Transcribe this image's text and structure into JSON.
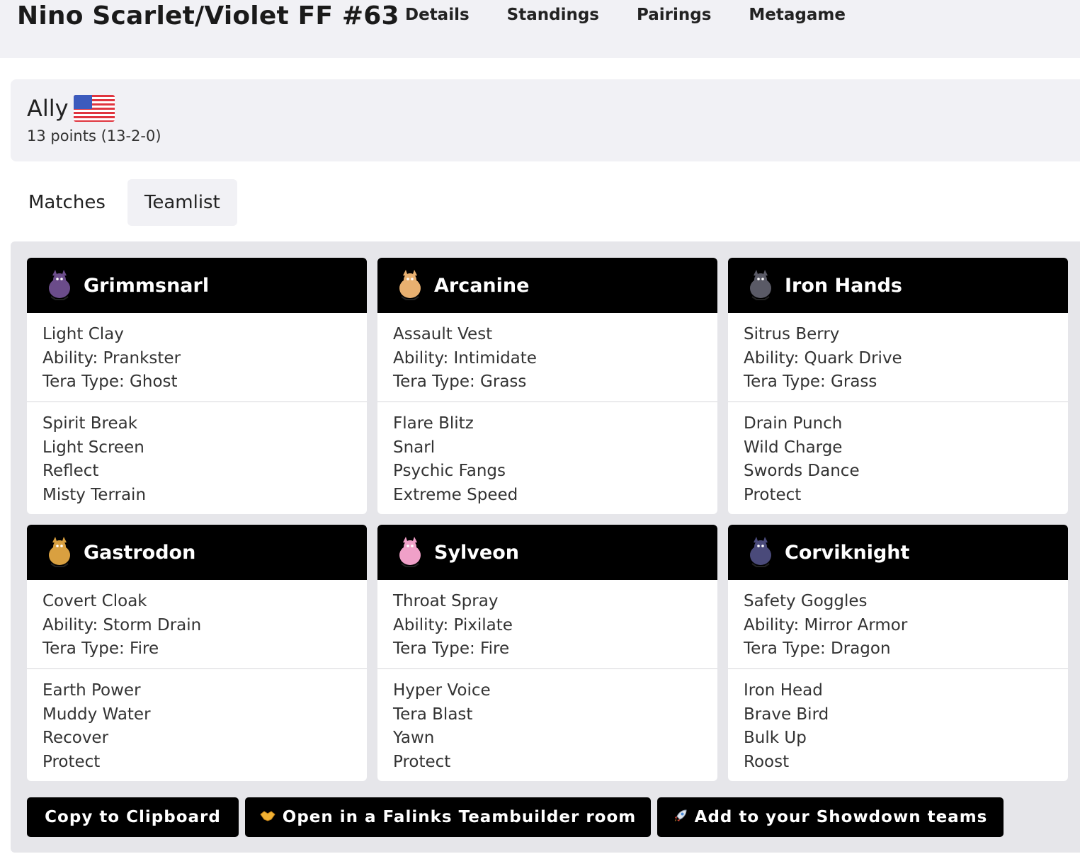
{
  "header": {
    "title": "Nino Scarlet/Violet FF #63",
    "nav": [
      "Details",
      "Standings",
      "Pairings",
      "Metagame"
    ]
  },
  "player": {
    "name": "Ally",
    "country_flag": "us-flag",
    "points": "13 points (13-2-0)"
  },
  "tabs": [
    {
      "label": "Matches",
      "active": false
    },
    {
      "label": "Teamlist",
      "active": true
    }
  ],
  "team": [
    {
      "name": "Grimmsnarl",
      "sprite_color": "#6b4c8a",
      "info": [
        "Light Clay",
        "Ability: Prankster",
        "Tera Type: Ghost"
      ],
      "moves": [
        "Spirit Break",
        "Light Screen",
        "Reflect",
        "Misty Terrain"
      ]
    },
    {
      "name": "Arcanine",
      "sprite_color": "#e8b070",
      "info": [
        "Assault Vest",
        "Ability: Intimidate",
        "Tera Type: Grass"
      ],
      "moves": [
        "Flare Blitz",
        "Snarl",
        "Psychic Fangs",
        "Extreme Speed"
      ]
    },
    {
      "name": "Iron Hands",
      "sprite_color": "#5a5a66",
      "info": [
        "Sitrus Berry",
        "Ability: Quark Drive",
        "Tera Type: Grass"
      ],
      "moves": [
        "Drain Punch",
        "Wild Charge",
        "Swords Dance",
        "Protect"
      ]
    },
    {
      "name": "Gastrodon",
      "sprite_color": "#d9a040",
      "info": [
        "Covert Cloak",
        "Ability: Storm Drain",
        "Tera Type: Fire"
      ],
      "moves": [
        "Earth Power",
        "Muddy Water",
        "Recover",
        "Protect"
      ]
    },
    {
      "name": "Sylveon",
      "sprite_color": "#f0a0c8",
      "info": [
        "Throat Spray",
        "Ability: Pixilate",
        "Tera Type: Fire"
      ],
      "moves": [
        "Hyper Voice",
        "Tera Blast",
        "Yawn",
        "Protect"
      ]
    },
    {
      "name": "Corviknight",
      "sprite_color": "#4a4a7a",
      "info": [
        "Safety Goggles",
        "Ability: Mirror Armor",
        "Tera Type: Dragon"
      ],
      "moves": [
        "Iron Head",
        "Brave Bird",
        "Bulk Up",
        "Roost"
      ]
    }
  ],
  "actions": [
    {
      "label": "Copy to Clipboard",
      "icon": ""
    },
    {
      "label": "Open in a Falinks Teambuilder room",
      "icon": "handshake-icon"
    },
    {
      "label": "Add to your Showdown teams",
      "icon": "rocket-icon"
    }
  ]
}
